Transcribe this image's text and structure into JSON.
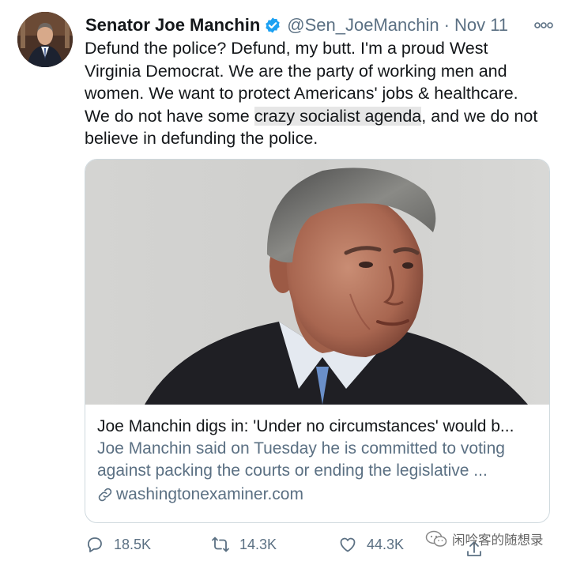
{
  "tweet": {
    "author_name": "Senator Joe Manchin",
    "handle": "@Sen_JoeManchin",
    "separator": "·",
    "date": "Nov 11",
    "text_lines": [
      "Defund the police? Defund, my butt. I'm a proud West",
      "Virginia Democrat. We are the party of working men and",
      "women. We want to protect Americans' jobs & healthcare."
    ],
    "line4_before": "We do not have some ",
    "line4_highlight": "crazy socialist agenda",
    "line4_after": ", and we do not",
    "line5": "believe in defunding the police."
  },
  "card": {
    "title": "Joe Manchin digs in: 'Under no circumstances' would b...",
    "description_lines": [
      "Joe Manchin said on Tuesday he is committed to voting",
      "against packing the courts or ending the legislative ..."
    ],
    "domain": "washingtonexaminer.com"
  },
  "actions": {
    "replies": "18.5K",
    "retweets": "14.3K",
    "likes": "44.3K"
  },
  "watermark": "闲吟客的随想录",
  "icons": {
    "verified": "verified-badge-icon",
    "more": "more-options-icon",
    "link": "link-icon",
    "reply": "reply-icon",
    "retweet": "retweet-icon",
    "like": "heart-icon",
    "share": "share-icon",
    "watermark": "wechat-icon"
  },
  "colors": {
    "verified": "#1da1f2",
    "secondary_text": "#5b7083",
    "highlight_bg": "#e6e6e6"
  }
}
